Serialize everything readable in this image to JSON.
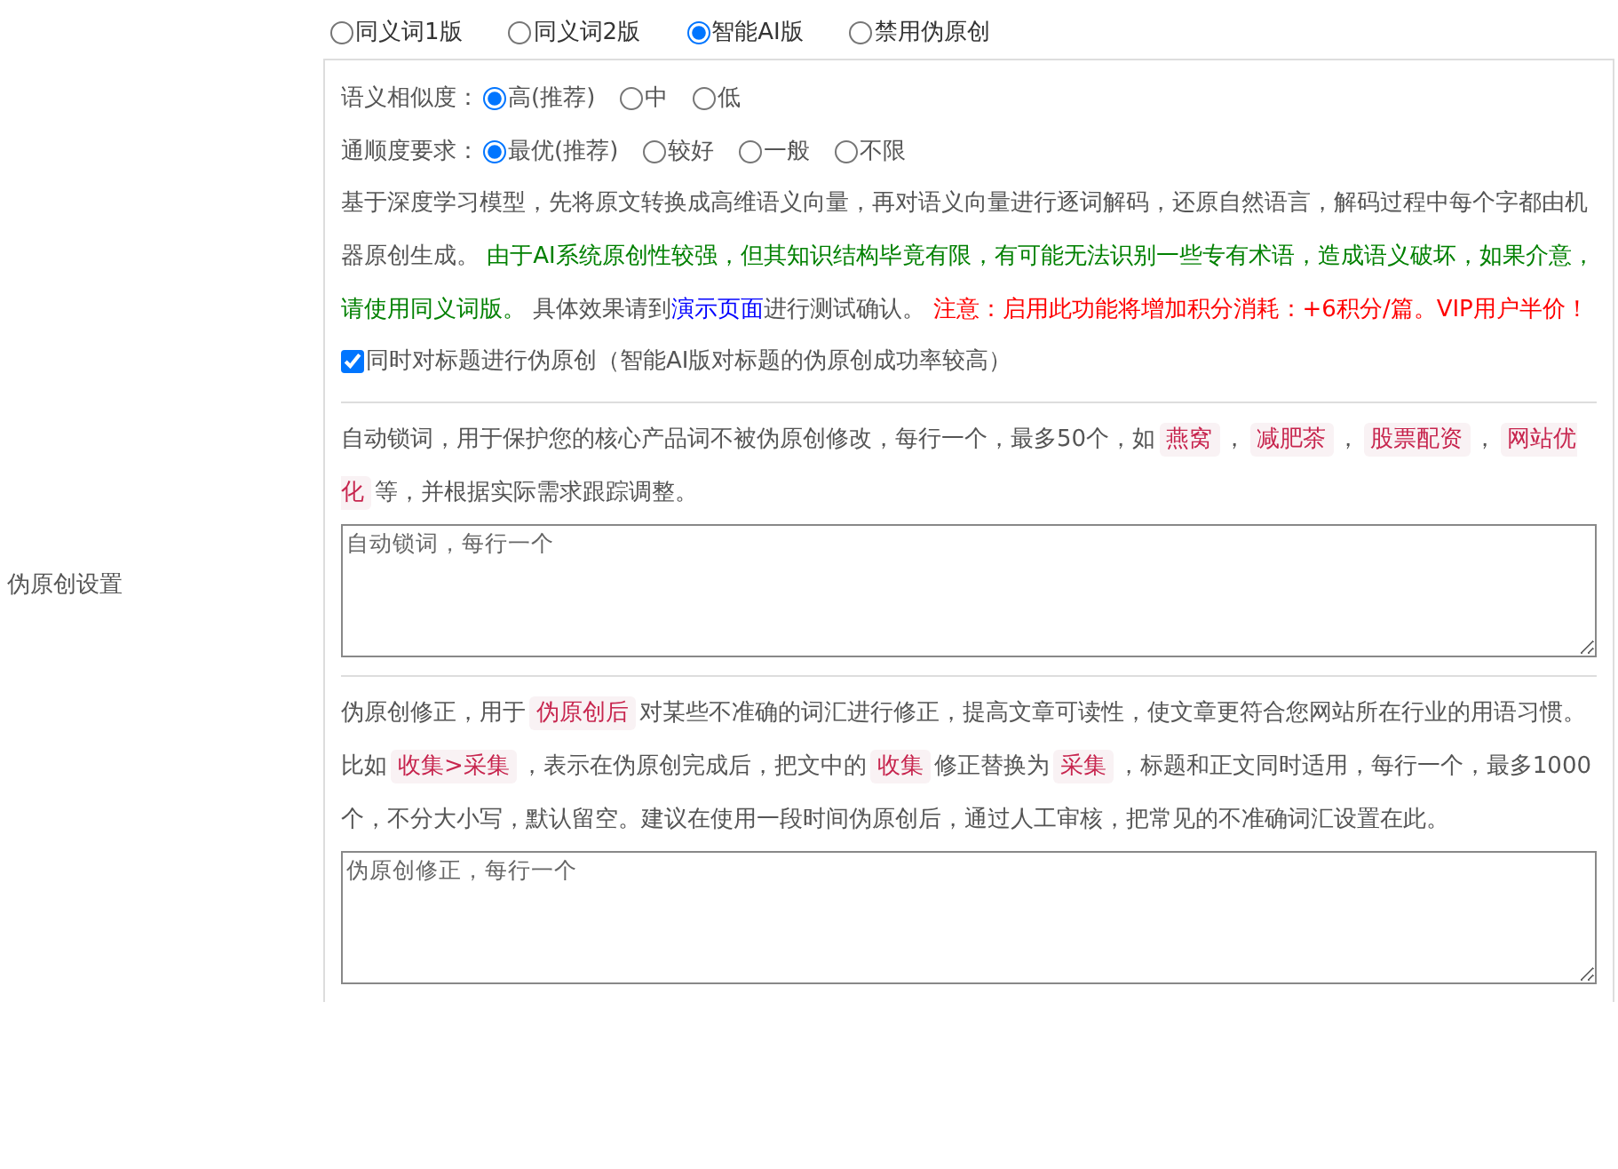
{
  "modes": [
    {
      "label": "同义词1版",
      "selected": false
    },
    {
      "label": "同义词2版",
      "selected": false
    },
    {
      "label": "智能AI版",
      "selected": true
    },
    {
      "label": "禁用伪原创",
      "selected": false
    }
  ],
  "settings": [
    {
      "label": "语义相似度：",
      "options": [
        {
          "label": "高(推荐)",
          "selected": true
        },
        {
          "label": "中",
          "selected": false
        },
        {
          "label": "低",
          "selected": false
        }
      ]
    },
    {
      "label": "通顺度要求：",
      "options": [
        {
          "label": "最优(推荐)",
          "selected": true
        },
        {
          "label": "较好",
          "selected": false
        },
        {
          "label": "一般",
          "selected": false
        },
        {
          "label": "不限",
          "selected": false
        }
      ]
    }
  ],
  "description": [
    {
      "kind": "plain",
      "text": "基于深度学习模型，先将原文转换成高维语义向量，再对语义向量进行逐词解码，还原自然语言，解码过程中每个字都由机器原创生成。 "
    },
    {
      "kind": "notice",
      "text": "由于AI系统原创性较强，但其知识结构毕竟有限，有可能无法识别一些专有术语，造成语义破坏，如果介意，请使用同义词版。"
    },
    {
      "kind": "plain",
      "text": " 具体效果请到"
    },
    {
      "kind": "link",
      "text": "演示页面"
    },
    {
      "kind": "plain",
      "text": "进行测试确认。 "
    },
    {
      "kind": "warning",
      "text": "注意：启用此功能将增加积分消耗：+6积分/篇。VIP用户半价！"
    }
  ],
  "title_option": {
    "label": "同时对标题进行伪原创（智能AI版对标题的伪原创成功率较高）",
    "checked": true
  },
  "auto_lock": {
    "label": "伪原创设置",
    "description": [
      {
        "kind": "plain",
        "text": "自动锁词，用于保护您的核心产品词不被伪原创修改，每行一个，最多50个，如"
      },
      {
        "kind": "tag",
        "text": "燕窝"
      },
      {
        "kind": "plain",
        "text": "，"
      },
      {
        "kind": "tag",
        "text": "减肥茶"
      },
      {
        "kind": "plain",
        "text": "，"
      },
      {
        "kind": "tag",
        "text": "股票配资"
      },
      {
        "kind": "plain",
        "text": "，"
      },
      {
        "kind": "tag",
        "text": "网站优化"
      },
      {
        "kind": "plain",
        "text": "等，并根据实际需求跟踪调整。"
      }
    ],
    "placeholder": "自动锁词，每行一个"
  },
  "correction": {
    "description": [
      {
        "kind": "plain",
        "text": "伪原创修正，用于"
      },
      {
        "kind": "tag",
        "text": "伪原创后"
      },
      {
        "kind": "plain",
        "text": "对某些不准确的词汇进行修正，提高文章可读性，使文章更符合您网站所在行业的用语习惯。比如"
      },
      {
        "kind": "tag",
        "text": "收集>采集"
      },
      {
        "kind": "plain",
        "text": "，表示在伪原创完成后，把文中的"
      },
      {
        "kind": "tag",
        "text": "收集"
      },
      {
        "kind": "plain",
        "text": "修正替换为"
      },
      {
        "kind": "tag",
        "text": "采集"
      },
      {
        "kind": "plain",
        "text": "，标题和正文同时适用，每行一个，最多1000个，不分大小写，默认留空。建议在使用一段时间伪原创后，通过人工审核，把常见的不准确词汇设置在此。"
      }
    ],
    "placeholder": "伪原创修正，每行一个"
  }
}
